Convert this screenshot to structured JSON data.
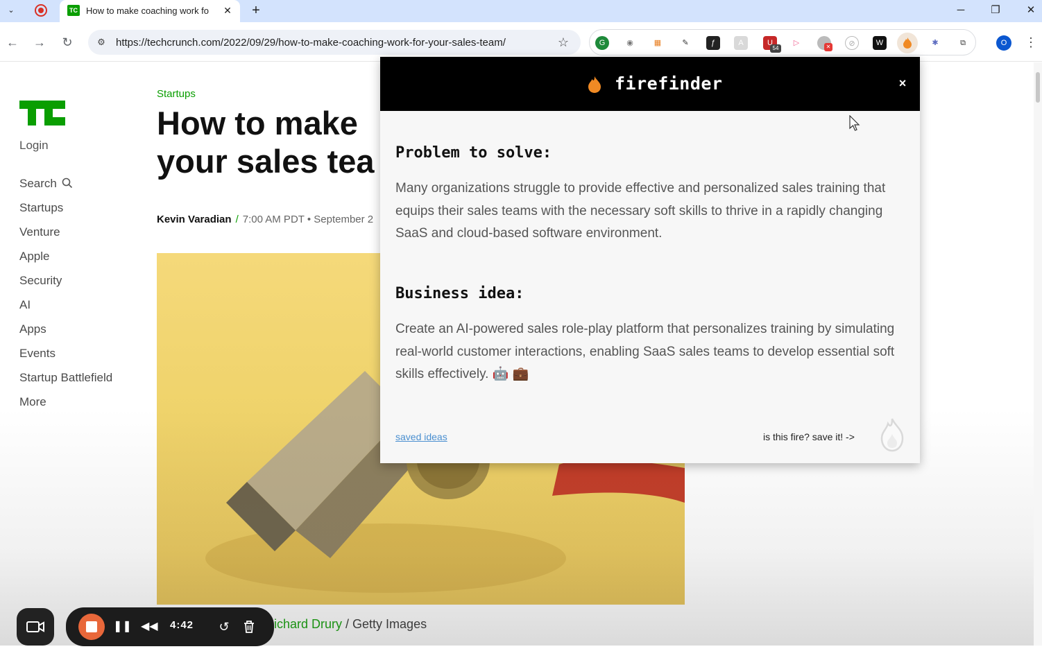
{
  "browser": {
    "tab": {
      "favicon_text": "TC",
      "title": "How to make coaching work fo",
      "close": "✕"
    },
    "new_tab": "+",
    "window_controls": {
      "minimize": "─",
      "restore": "❐",
      "close": "✕"
    },
    "url": "https://techcrunch.com/2022/09/29/how-to-make-coaching-work-for-your-sales-team/",
    "profile_initial": "O",
    "extension_badge": "54"
  },
  "site": {
    "login": "Login",
    "nav": [
      "Search",
      "Startups",
      "Venture",
      "Apple",
      "Security",
      "AI",
      "Apps",
      "Events",
      "Startup Battlefield",
      "More"
    ],
    "category": "Startups",
    "headline": [
      "How to make",
      "your sales tea"
    ],
    "author": "Kevin Varadian",
    "separator": "/",
    "date": "7:00 AM PDT • September 2",
    "caption_credit": "ichard Drury",
    "caption_source": " / Getty Images"
  },
  "popup": {
    "brand": "firefinder",
    "close": "×",
    "problem_title": "Problem to solve:",
    "problem_text": "Many organizations struggle to provide effective and personalized sales training that equips their sales teams with the necessary soft skills to thrive in a rapidly changing SaaS and cloud-based software environment.",
    "idea_title": "Business idea:",
    "idea_text": "Create an AI-powered sales role-play platform that personalizes training by simulating real-world customer interactions, enabling SaaS sales teams to develop essential soft skills effectively. 🤖 💼",
    "saved_ideas": "saved ideas",
    "save_prompt": "is this fire? save it! ->"
  },
  "recorder": {
    "time": "4:42"
  },
  "colors": {
    "tc_green": "#0a9e01",
    "tabstrip": "#d3e3fd",
    "flame": "#f08a24",
    "recorder_stop": "#e8673a"
  }
}
